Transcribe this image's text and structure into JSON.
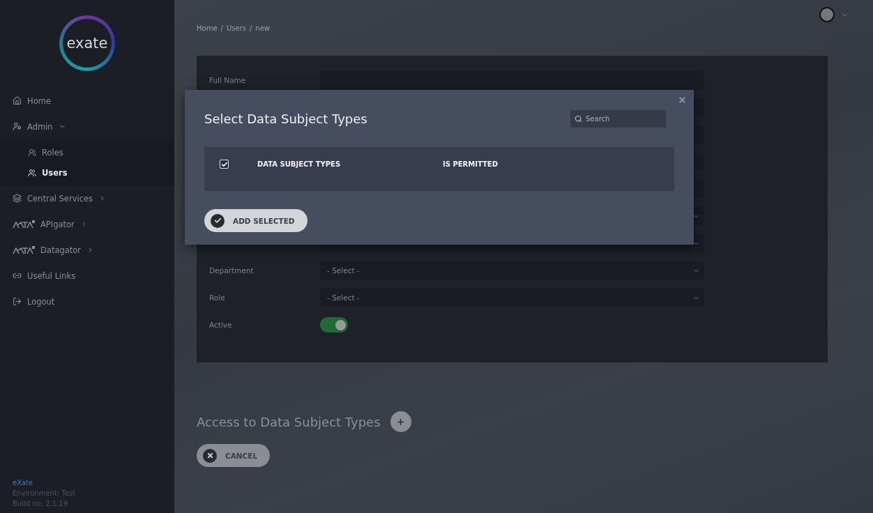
{
  "sidebar": {
    "logo": "exate",
    "items": [
      {
        "label": "Home",
        "selected": false
      },
      {
        "label": "Admin",
        "selected": false,
        "expanded": true,
        "children": [
          {
            "label": "Roles",
            "selected": false
          },
          {
            "label": "Users",
            "selected": true
          }
        ]
      },
      {
        "label": "Central Services",
        "selected": false,
        "expanded": false
      },
      {
        "label": "APIgator",
        "selected": false,
        "expanded": false
      },
      {
        "label": "Datagator",
        "selected": false,
        "expanded": false
      },
      {
        "label": "Useful Links",
        "selected": false
      },
      {
        "label": "Logout",
        "selected": false
      }
    ],
    "footer": {
      "brand": "eXate",
      "environment": "Environment: Test",
      "build": "Build no: 2.1.19"
    }
  },
  "breadcrumb": {
    "items": [
      "Home",
      "Users",
      "new"
    ],
    "separator": "/"
  },
  "form": {
    "fields": [
      {
        "kind": "text",
        "label": "Full Name"
      },
      {
        "kind": "text"
      },
      {
        "kind": "text"
      },
      {
        "kind": "text"
      },
      {
        "kind": "text"
      },
      {
        "kind": "select"
      },
      {
        "kind": "select"
      },
      {
        "kind": "select",
        "label": "Department",
        "value": "- Select -"
      },
      {
        "kind": "select",
        "label": "Role",
        "value": "- Select -"
      },
      {
        "kind": "toggle",
        "label": "Active",
        "on": true
      }
    ]
  },
  "section": {
    "title": "Access to Data Subject Types"
  },
  "cancel_button": "CANCEL",
  "modal": {
    "title": "Select Data Subject Types",
    "search": {
      "placeholder": "Search"
    },
    "table": {
      "select_all": {
        "checked": true
      },
      "columns": [
        "DATA SUBJECT TYPES",
        "IS PERMITTED"
      ]
    },
    "add_button": "ADD SELECTED"
  }
}
